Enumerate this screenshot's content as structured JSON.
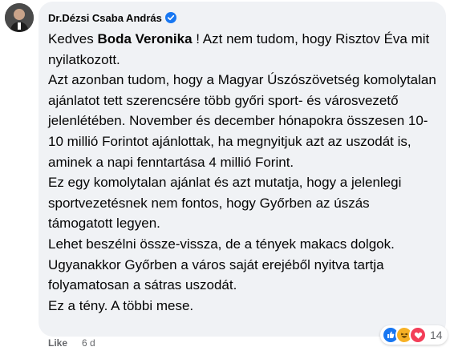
{
  "comment": {
    "author": "Dr.Dézsi Csaba András",
    "verified": true,
    "paragraphs": [
      {
        "prefix": "Kedves ",
        "mention": "Boda Veronika",
        "rest": " ! Azt nem tudom, hogy Risztov Éva mit nyilatkozott."
      },
      {
        "text": "Azt azonban tudom, hogy a Magyar Úszószövetség komolytalan ajánlatot tett szerencsére több győri sport- és városvezető jelenlétében. November és december hónapokra összesen 10-10 millió Forintot ajánlottak, ha megnyitjuk azt az uszodát is, aminek a napi fenntartása 4 millió Forint."
      },
      {
        "text": "Ez egy komolytalan ajánlat és azt mutatja, hogy a jelenlegi sportvezetésnek nem fontos, hogy Győrben az úszás támogatott legyen."
      },
      {
        "text": "Lehet beszélni össze-vissza, de a tények makacs dolgok."
      },
      {
        "text": "Ugyanakkor Győrben a város saját erejéből nyitva tartja folyamatosan a sátras uszodát."
      },
      {
        "text": "Ez a tény. A többi mese."
      }
    ],
    "reactions": {
      "icons": [
        "like-icon",
        "haha-icon",
        "love-icon"
      ],
      "count": "14"
    },
    "actions": {
      "like_label": "Like",
      "time": "6 d"
    }
  },
  "colors": {
    "bubble_bg": "#f0f2f5",
    "verified_blue": "#1877f2",
    "like_blue": "#1877f2",
    "love_red": "#f33e58",
    "haha_yellow": "#f7b125",
    "meta_gray": "#65676b"
  }
}
